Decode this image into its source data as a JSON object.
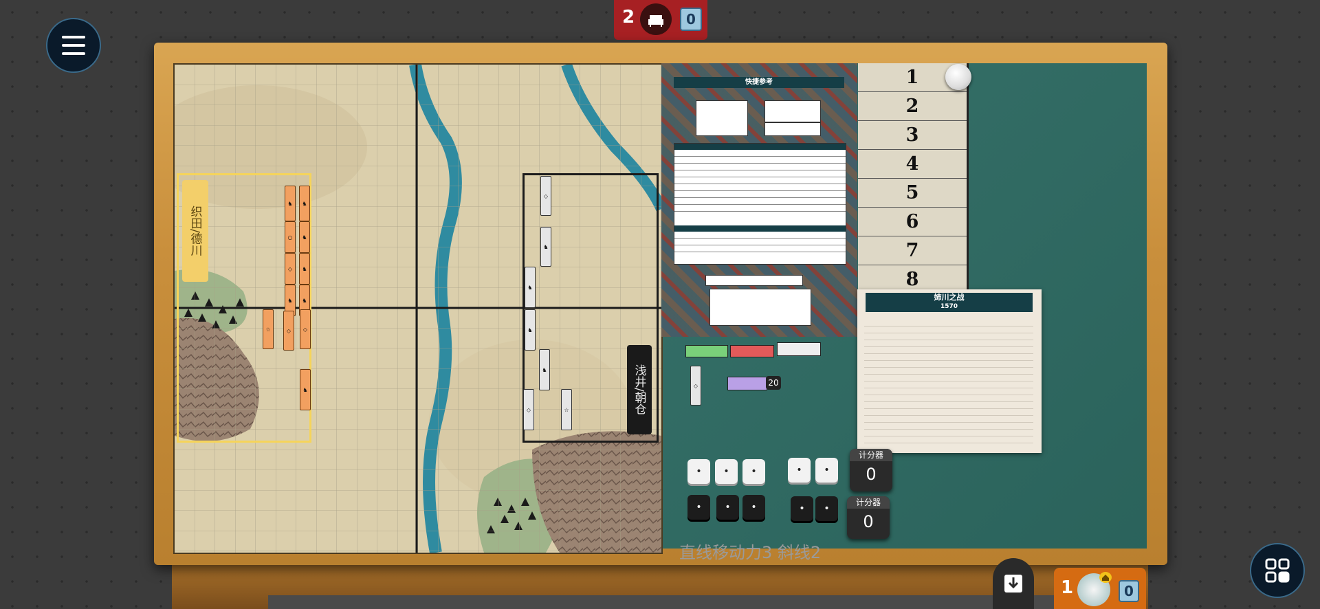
{
  "top_player": {
    "score": "2",
    "cards": "0",
    "icon": "chair-icon"
  },
  "bottom_player": {
    "score": "1",
    "cards": "0",
    "icon": "home-icon"
  },
  "menu_icon": "hamburger-icon",
  "apps_icon": "grid-icon",
  "download_icon": "download-icon",
  "map": {
    "oda_label": "织田/德川",
    "azai_label": "浅井/朝仓"
  },
  "reference": {
    "title": "快捷参考",
    "rows": [
      "",
      "",
      "",
      "",
      "",
      "",
      "",
      "",
      ""
    ]
  },
  "turn_track": [
    "1",
    "2",
    "3",
    "4",
    "5",
    "6",
    "7",
    "8"
  ],
  "scenario": {
    "title": "姉川之战",
    "year": "1570"
  },
  "unit_stacks": {
    "last_count": "20"
  },
  "counters": [
    {
      "label": "计分器",
      "value": "0"
    },
    {
      "label": "计分器",
      "value": "0"
    }
  ],
  "dice": {
    "white_group_1": [
      "•",
      "•",
      "•"
    ],
    "white_group_2": [
      "•",
      "•"
    ],
    "black_group_1": [
      "•",
      "•",
      "•"
    ],
    "black_group_2": [
      "•",
      "•"
    ]
  },
  "move_note": "直线移动力3 斜线2",
  "colors": {
    "felt": "#2e6b63",
    "table": "#c98f3c",
    "top_player": "#a72023",
    "bottom_player": "#d56b12"
  }
}
